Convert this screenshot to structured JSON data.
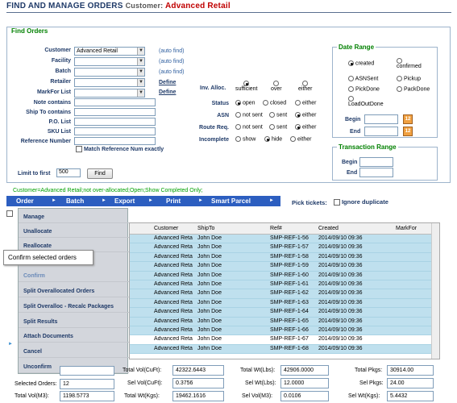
{
  "header": {
    "title": "Find and Manage Orders",
    "customer_label": "Customer:",
    "customer_value": "Advanced Retail"
  },
  "find": {
    "section_title": "Find Orders",
    "customer": {
      "label": "Customer",
      "value": "Advanced Retail",
      "hint": "(auto find)"
    },
    "facility": {
      "label": "Facility",
      "hint": "(auto find)"
    },
    "batch": {
      "label": "Batch",
      "hint": "(auto find)"
    },
    "retailer": {
      "label": "Retailer",
      "link": "Define"
    },
    "markfor": {
      "label": "MarkFor List",
      "link": "Define"
    },
    "note": {
      "label": "Note contains"
    },
    "shipto": {
      "label": "Ship To contains"
    },
    "po": {
      "label": "P.O. List"
    },
    "sku": {
      "label": "SKU List"
    },
    "ref": {
      "label": "Reference Number"
    },
    "match_label": "Match Reference Num exactly",
    "limit_label": "Limit to first",
    "limit_value": "500",
    "find_button": "Find"
  },
  "filters": {
    "inv_alloc": {
      "label": "Inv. Alloc.",
      "options": [
        "sufficient",
        "over",
        "either"
      ]
    },
    "status": {
      "label": "Status",
      "options": [
        "open",
        "closed",
        "either"
      ]
    },
    "asn": {
      "label": "ASN",
      "options": [
        "not sent",
        "sent",
        "either"
      ]
    },
    "route": {
      "label": "Route Req.",
      "options": [
        "not sent",
        "sent",
        "either"
      ]
    },
    "incomplete": {
      "label": "Incomplete",
      "options": [
        "show",
        "hide",
        "either"
      ]
    }
  },
  "date_range": {
    "title": "Date Range",
    "options": [
      "created",
      "confirmed",
      "ASNSent",
      "Pickup",
      "PickDone",
      "PackDone",
      "LoadOutDone"
    ],
    "begin": "Begin",
    "end": "End",
    "cal": "12"
  },
  "txn_range": {
    "title": "Transaction Range",
    "begin": "Begin",
    "end": "End"
  },
  "criteria_text": "Customer=Advanced Retail;not over-allocated;Open;Show Completed Only;",
  "menu": {
    "items": [
      "Order",
      "Batch",
      "Export",
      "Print",
      "Smart Parcel"
    ]
  },
  "pick": {
    "label": "Pick tickets:",
    "ignore": "Ignore duplicate"
  },
  "dropdown": {
    "items": [
      "Manage",
      "Unallocate",
      "Reallocate",
      "",
      "Confirm",
      "Split Overallocated Orders",
      "Split Overalloc - Recalc Packages",
      "Split Results",
      "Attach Documents",
      "Cancel",
      "Unconfirm"
    ]
  },
  "tooltip": "Confirm selected orders",
  "grid": {
    "columns": [
      "Customer",
      "ShipTo",
      "Ref#",
      "Created",
      "MarkFor"
    ],
    "rows": [
      [
        "Advanced Reta",
        "John Doe",
        "SMP-REF-1-56",
        "2014/09/10 09:36",
        ""
      ],
      [
        "Advanced Reta",
        "John Doe",
        "SMP-REF-1-57",
        "2014/09/10 09:36",
        ""
      ],
      [
        "Advanced Reta",
        "John Doe",
        "SMP-REF-1-58",
        "2014/09/10 09:36",
        ""
      ],
      [
        "Advanced Reta",
        "John Doe",
        "SMP-REF-1-59",
        "2014/09/10 09:36",
        ""
      ],
      [
        "Advanced Reta",
        "John Doe",
        "SMP-REF-1-60",
        "2014/09/10 09:36",
        ""
      ],
      [
        "Advanced Reta",
        "John Doe",
        "SMP-REF-1-61",
        "2014/09/10 09:36",
        ""
      ],
      [
        "Advanced Reta",
        "John Doe",
        "SMP-REF-1-62",
        "2014/09/10 09:36",
        ""
      ],
      [
        "Advanced Reta",
        "John Doe",
        "SMP-REF-1-63",
        "2014/09/10 09:36",
        ""
      ],
      [
        "Advanced Reta",
        "John Doe",
        "SMP-REF-1-64",
        "2014/09/10 09:36",
        ""
      ],
      [
        "Advanced Reta",
        "John Doe",
        "SMP-REF-1-65",
        "2014/09/10 09:36",
        ""
      ],
      [
        "Advanced Reta",
        "John Doe",
        "SMP-REF-1-66",
        "2014/09/10 09:36",
        ""
      ],
      [
        "Advanced Reta",
        "John Doe",
        "SMP-REF-1-67",
        "2014/09/10 09:36",
        ""
      ],
      [
        "Advanced Reta",
        "John Doe",
        "SMP-REF-1-68",
        "2014/09/10 09:36",
        ""
      ]
    ]
  },
  "totals": {
    "selected_orders": {
      "label": "Selected Orders:",
      "value": "12"
    },
    "total_vol_m3": {
      "label": "Total Vol(M3):",
      "value": "1198.5773"
    },
    "total_vol_cuft": {
      "label": "Total Vol(CuFt):",
      "value": "42322.6443"
    },
    "sel_vol_cuft": {
      "label": "Sel Vol(CuFt):",
      "value": "0.3756"
    },
    "total_wt_kgs": {
      "label": "Total Wt(Kgs):",
      "value": "19462.1616"
    },
    "total_wt_lbs": {
      "label": "Total Wt(Lbs):",
      "value": "42906.0000"
    },
    "sel_wt_lbs": {
      "label": "Sel Wt(Lbs):",
      "value": "12.0000"
    },
    "sel_vol_m3": {
      "label": "Sel Vol(M3):",
      "value": "0.0106"
    },
    "total_pkgs": {
      "label": "Total Pkgs:",
      "value": "30914.00"
    },
    "sel_pkgs": {
      "label": "Sel Pkgs:",
      "value": "24.00"
    },
    "sel_wt_kgs": {
      "label": "Sel Wt(Kgs):",
      "value": "5.4432"
    }
  },
  "colors": {
    "header": "#1f3a68",
    "accent": "#c00000",
    "menubar": "#2c5ec0",
    "section": "#008000",
    "row_selected": "#bfe0ee"
  }
}
